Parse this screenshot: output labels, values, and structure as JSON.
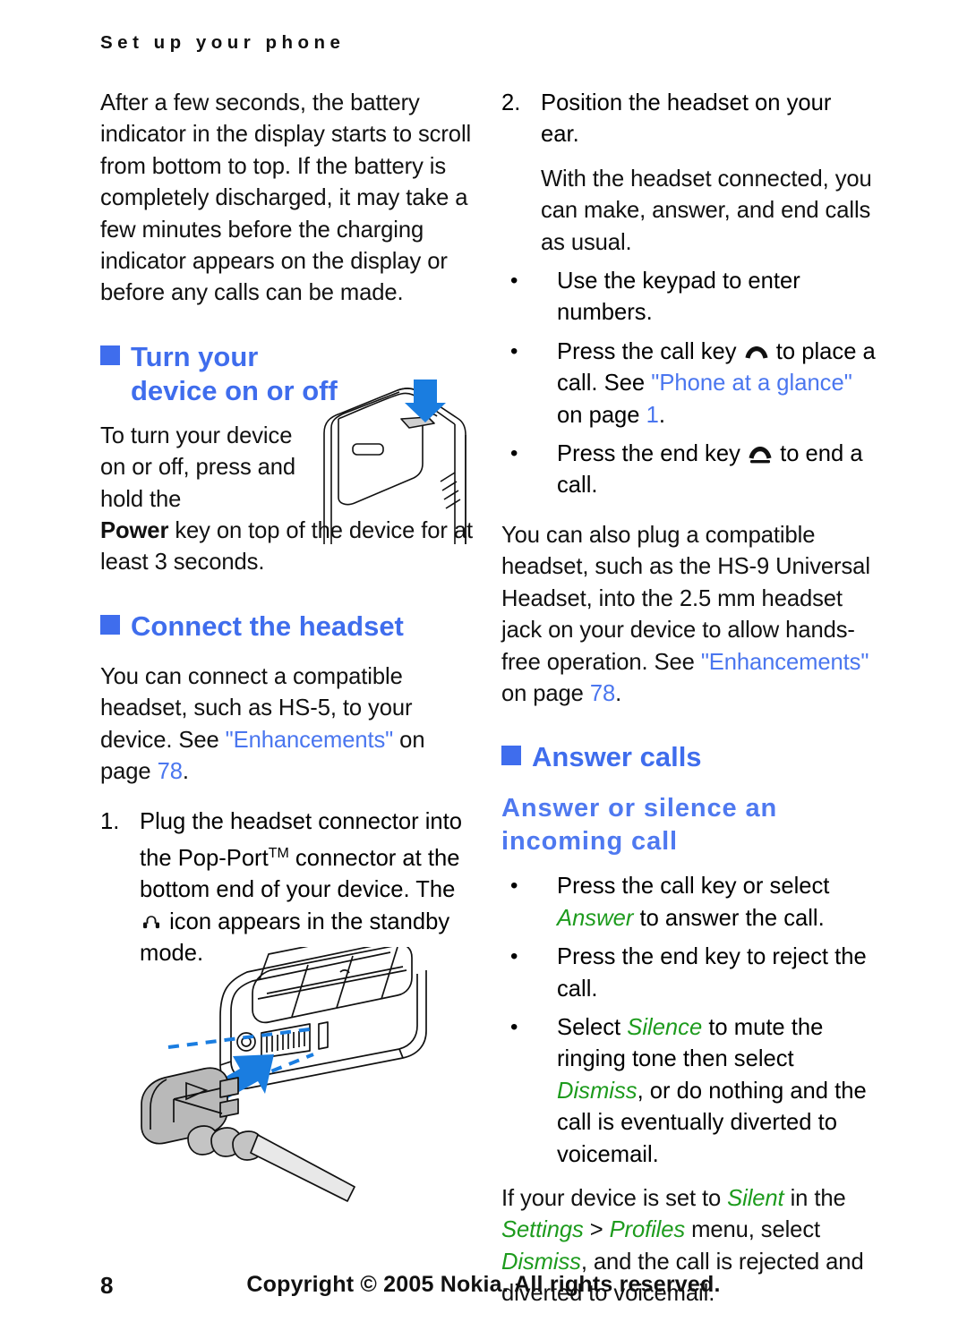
{
  "header": {
    "running_head": "Set up your phone"
  },
  "left_column": {
    "intro_paragraph": "After a few seconds, the battery indicator in the display starts to scroll from bottom to top. If the battery is completely discharged, it may take a few minutes before the charging indicator appears on the display or before any calls can be made.",
    "section_turn_on": {
      "heading": "Turn your device on or off",
      "body_part1": "To turn your device on or off, press and hold the ",
      "body_power_key": "Power",
      "body_part2": " key on top of the device for at least 3 seconds.",
      "figure_alt": "phone-power-key-illustration"
    },
    "section_connect_headset": {
      "heading": "Connect the headset",
      "body_part1": "You can connect a compatible headset, such as HS-5, to your device. See ",
      "body_link": "\"Enhancements\"",
      "body_part2": " on page ",
      "body_page": "78",
      "body_part3": ".",
      "step1_marker": "1.",
      "step1_part1": "Plug the headset connector into the Pop-Port",
      "step1_tm": "TM",
      "step1_part2": " connector at the bottom end of your device. The ",
      "step1_part3": " icon appears in the standby mode.",
      "figure_alt": "pop-port-connector-illustration"
    }
  },
  "right_column": {
    "step2_marker": "2.",
    "step2_text": "Position the headset on your ear.",
    "step2_body": "With the headset connected, you can make, answer, and end calls as usual.",
    "bullets_headset": [
      {
        "marker": "•",
        "text": "Use the keypad to enter numbers."
      },
      {
        "marker": "•",
        "part1": "Press the call key ",
        "icon": "call-key-icon",
        "part2": " to place a call. See ",
        "link": "\"Phone at a glance\"",
        "part3": " on page ",
        "page": "1",
        "part4": "."
      },
      {
        "marker": "•",
        "part1": "Press the end key ",
        "icon": "end-key-icon",
        "part2": " to end a call."
      }
    ],
    "universal_headset_part1": "You can also plug a compatible headset, such as the HS-9 Universal Headset, into the 2.5 mm headset jack on your device to allow hands-free operation. See ",
    "universal_headset_link": "\"Enhancements\"",
    "universal_headset_part2": " on page ",
    "universal_headset_page": "78",
    "universal_headset_part3": ".",
    "section_answer_calls": {
      "heading": "Answer calls",
      "subheading": "Answer or silence an incoming call",
      "bullets": [
        {
          "marker": "•",
          "part1": "Press the call key or select ",
          "ui_term": "Answer",
          "part2": " to answer the call."
        },
        {
          "marker": "•",
          "part1": "Press the end key to reject the call."
        },
        {
          "marker": "•",
          "part1": "Select ",
          "ui_term": "Silence",
          "part2": " to mute the ringing tone then select ",
          "ui_term2": "Dismiss",
          "part3": ", or do nothing and the call is eventually diverted to voicemail."
        }
      ],
      "final_part1": "If your device is set to ",
      "final_ui1": "Silent",
      "final_part2": " in the ",
      "final_ui2": "Settings",
      "final_sep": " > ",
      "final_ui3": "Profiles",
      "final_part3": " menu, select ",
      "final_ui4": "Dismiss",
      "final_part4": ", and the call is rejected and diverted to voicemail."
    }
  },
  "footer": {
    "page_number": "8",
    "copyright": "Copyright © 2005 Nokia. All rights reserved."
  },
  "colors": {
    "heading_blue": "#3f6ded",
    "subheading_blue": "#4f79f0",
    "link_blue": "#4a76ef",
    "ui_term_green": "#1d9b1d",
    "illustration_blue": "#1a7de0",
    "text_black": "#111111"
  }
}
